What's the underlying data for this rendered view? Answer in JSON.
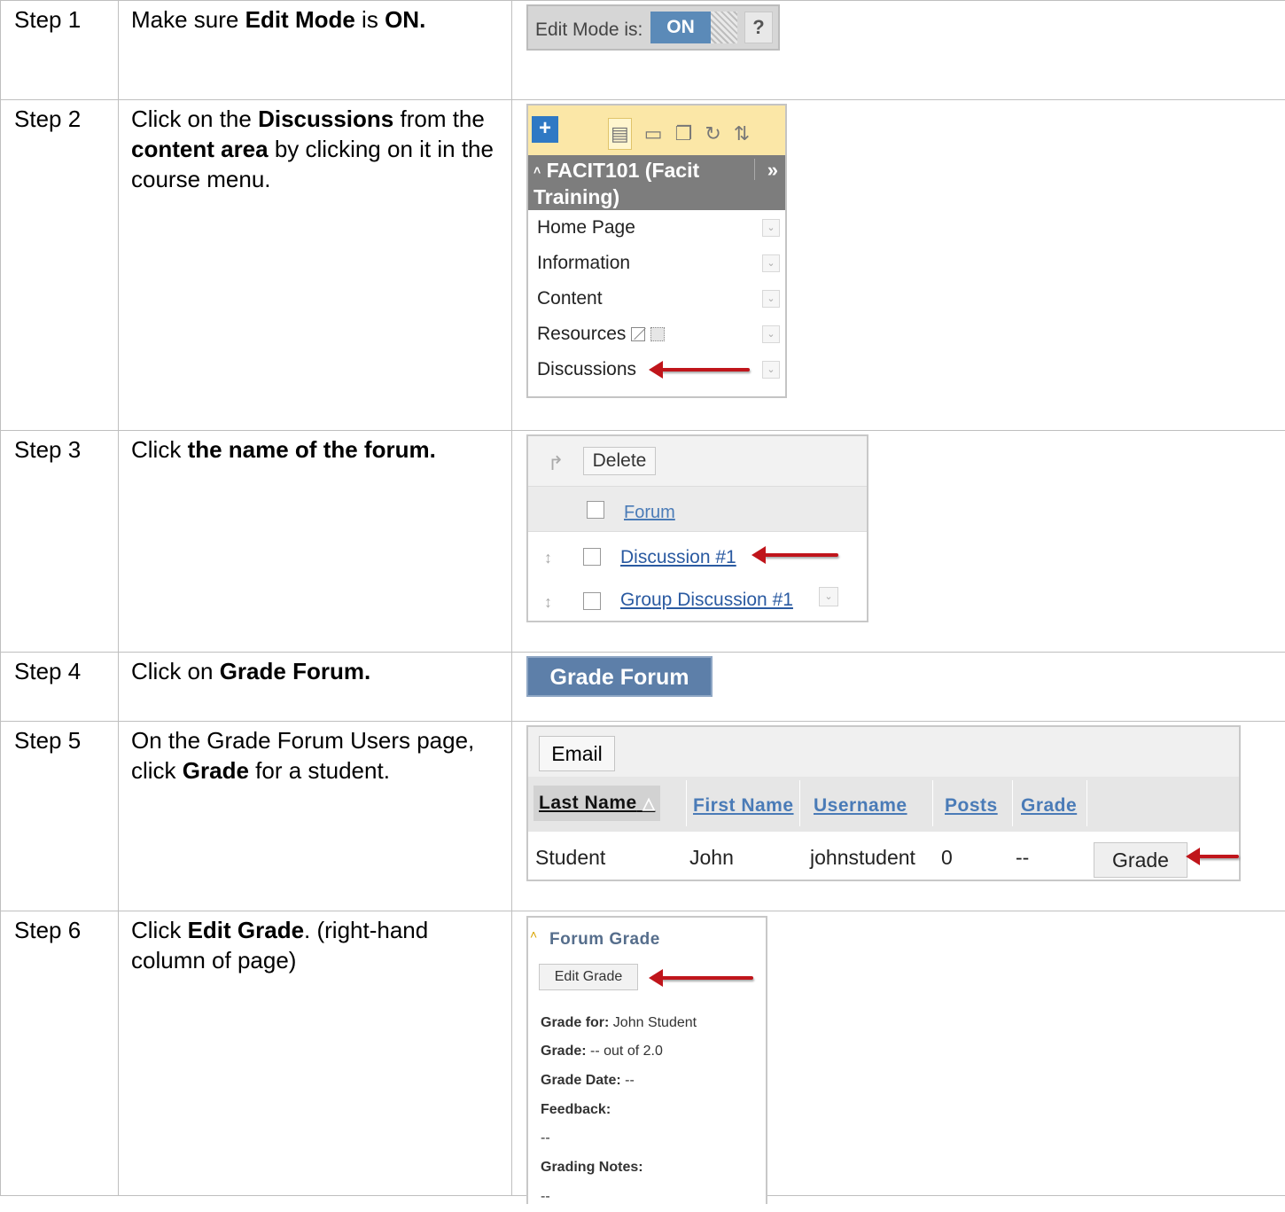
{
  "steps": [
    {
      "label": "Step 1",
      "pre": "Make sure ",
      "b1": "Edit Mode",
      "mid": " is ",
      "b2": "ON.",
      "post": ""
    },
    {
      "label": "Step 2",
      "pre": "Click on the ",
      "b1": "Discussions",
      "mid": " from the ",
      "b2": "content area",
      "post": " by clicking on it in the course menu."
    },
    {
      "label": "Step 3",
      "pre": "Click ",
      "b1": "the name of the forum.",
      "mid": "",
      "b2": "",
      "post": ""
    },
    {
      "label": "Step 4",
      "pre": "Click on ",
      "b1": "Grade Forum.",
      "mid": "",
      "b2": "",
      "post": ""
    },
    {
      "label": "Step 5",
      "pre": "On the Grade Forum Users page, click ",
      "b1": "Grade",
      "mid": " for a student.",
      "b2": "",
      "post": ""
    },
    {
      "label": "Step 6",
      "pre": "Click ",
      "b1": "Edit Grade",
      "mid": ". (right-hand column of page)",
      "b2": "",
      "post": ""
    }
  ],
  "step1": {
    "label": "Edit Mode is:",
    "state": "ON",
    "help": "?"
  },
  "step2": {
    "plus": "+",
    "course": "FACIT101 (Facit Training)",
    "collapse": "»",
    "items": [
      "Home Page",
      "Information",
      "Content",
      "Resources",
      "Discussions"
    ]
  },
  "step3": {
    "delete": "Delete",
    "header": "Forum",
    "rows": [
      "Discussion #1",
      "Group Discussion #1"
    ]
  },
  "step4": {
    "button": "Grade Forum"
  },
  "step5": {
    "email": "Email",
    "headers": [
      "Last Name",
      "First Name",
      "Username",
      "Posts",
      "Grade"
    ],
    "row": {
      "last": "Student",
      "first": "John",
      "username": "johnstudent",
      "posts": "0",
      "grade": "--"
    },
    "grade_button": "Grade"
  },
  "step6": {
    "title": "Forum Grade",
    "edit": "Edit Grade",
    "grade_for_label": "Grade for:",
    "grade_for": "John Student",
    "grade_label": "Grade:",
    "grade": "-- out of 2.0",
    "date_label": "Grade Date:",
    "date": "--",
    "feedback_label": "Feedback:",
    "feedback": "--",
    "notes_label": "Grading Notes:",
    "notes": "--"
  },
  "colors": {
    "arrow": "#c0151b",
    "on": "#5b8ab8",
    "grade_forum": "#5d7fa9",
    "course_bar": "#7d7d7d",
    "toolbar": "#fbe7a7"
  }
}
